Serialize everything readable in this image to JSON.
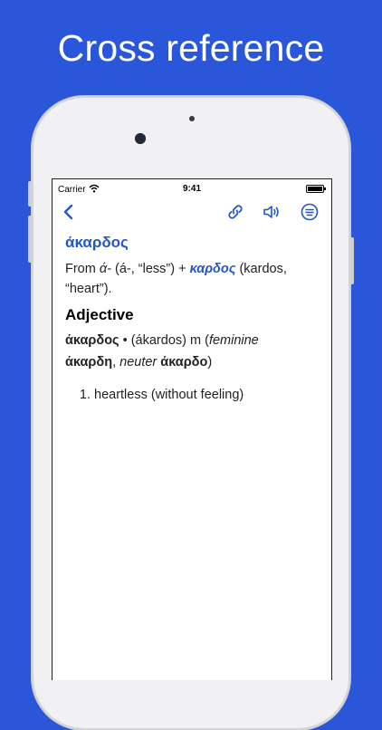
{
  "banner": {
    "title": "Cross reference"
  },
  "status_bar": {
    "carrier": "Carrier",
    "time": "9:41"
  },
  "toolbar": {
    "back_icon": "chevron-left-icon",
    "link_icon": "link-icon",
    "audio_icon": "speaker-icon",
    "menu_icon": "list-menu-icon",
    "accent_color": "#2456c4"
  },
  "entry": {
    "headword": "άκαρδος",
    "etymology": {
      "from": "From ",
      "prefix": "ά-",
      "prefix_gloss": " (á-, “less”) + ",
      "link_word": "καρδος",
      "rest": " (kardos, “heart”)."
    },
    "pos": "Adjective",
    "forms": {
      "lemma": "άκαρδος",
      "translit": " • (ákardos) m (",
      "feminine_label": "feminine",
      "feminine_form": "άκαρδη",
      "neuter_label": "neuter",
      "neuter_form": "άκαρδο",
      "close": ")"
    },
    "definitions": [
      {
        "num": "1.",
        "text": "heartless (without feeling)"
      }
    ]
  }
}
